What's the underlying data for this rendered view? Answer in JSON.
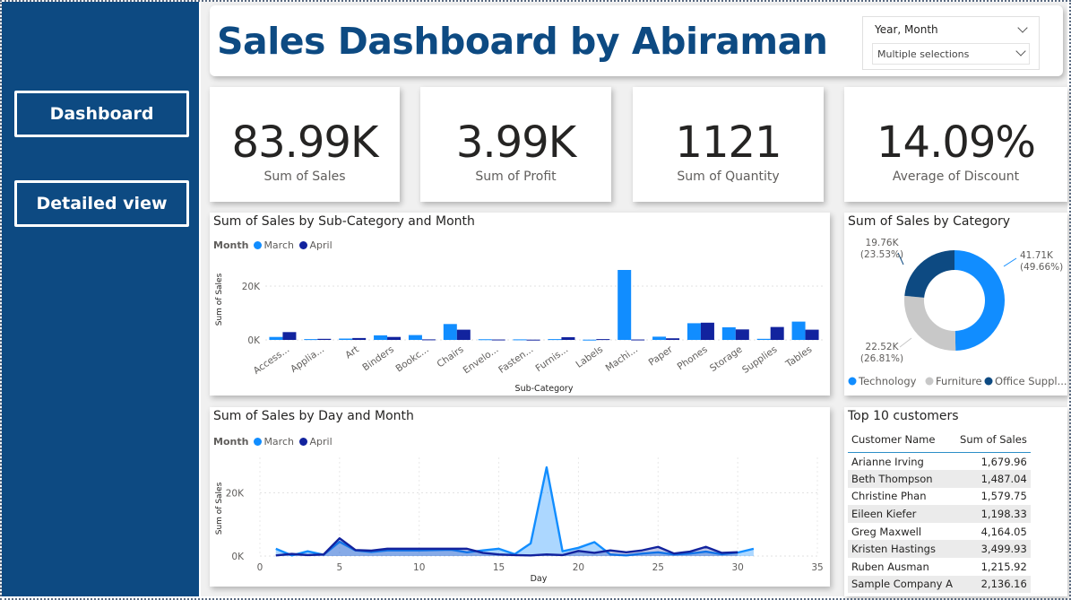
{
  "nav": {
    "dashboard": "Dashboard",
    "detailed": "Detailed view"
  },
  "header": {
    "title": "Sales Dashboard by Abiraman"
  },
  "slicer": {
    "label": "Year, Month",
    "value": "Multiple selections"
  },
  "kpis": [
    {
      "value": "83.99K",
      "label": "Sum of Sales"
    },
    {
      "value": "3.99K",
      "label": "Sum of Profit"
    },
    {
      "value": "1121",
      "label": "Sum of Quantity"
    },
    {
      "value": "14.09%",
      "label": "Average of Discount"
    }
  ],
  "colors": {
    "march": "#118dff",
    "april": "#12239e",
    "technology": "#118dff",
    "furniture": "#c8c8c8",
    "office": "#0d4a82",
    "nav_bg": "#0d4a82"
  },
  "charts": {
    "subcat": {
      "title": "Sum of Sales by Sub-Category and Month",
      "legend_title": "Month",
      "xlabel": "Sub-Category",
      "ylabel": "Sum of Sales",
      "yticks": [
        "20K",
        "0K"
      ]
    },
    "donut": {
      "title": "Sum of Sales by Category"
    },
    "daily": {
      "title": "Sum of Sales by Day and Month",
      "legend_title": "Month",
      "xlabel": "Day",
      "ylabel": "Sum of Sales",
      "yticks": [
        "20K",
        "0K"
      ]
    }
  },
  "chart_data": [
    {
      "type": "bar",
      "title": "Sum of Sales by Sub-Category and Month",
      "xlabel": "Sub-Category",
      "ylabel": "Sum of Sales",
      "ylim": [
        0,
        30000
      ],
      "legend_placement": "top-left",
      "categories": [
        "Access...",
        "Applia...",
        "Art",
        "Binders",
        "Bookc...",
        "Chairs",
        "Envelo...",
        "Fasten...",
        "Furnis...",
        "Labels",
        "Machi...",
        "Paper",
        "Phones",
        "Storage",
        "Supplies",
        "Tables"
      ],
      "series": [
        {
          "name": "March",
          "values": [
            1100,
            300,
            500,
            1700,
            1800,
            5900,
            250,
            200,
            300,
            100,
            26000,
            1200,
            6200,
            4700,
            400,
            6800
          ]
        },
        {
          "name": "April",
          "values": [
            2900,
            400,
            700,
            1100,
            200,
            3800,
            150,
            100,
            1000,
            300,
            150,
            600,
            6400,
            3900,
            4800,
            3800
          ]
        }
      ]
    },
    {
      "type": "pie",
      "title": "Sum of Sales by Category",
      "legend_placement": "bottom",
      "labels": [
        "Technology",
        "Furniture",
        "Office Suppl..."
      ],
      "values": [
        41710,
        22520,
        19760
      ],
      "value_labels": [
        "41.71K",
        "22.52K",
        "19.76K"
      ],
      "percent_labels": [
        "(49.66%)",
        "(26.81%)",
        "(23.53%)"
      ]
    },
    {
      "type": "area",
      "title": "Sum of Sales by Day and Month",
      "xlabel": "Day",
      "ylabel": "Sum of Sales",
      "xlim": [
        0,
        35
      ],
      "ylim": [
        0,
        30000
      ],
      "xticks": [
        0,
        5,
        10,
        15,
        20,
        25,
        30,
        35
      ],
      "legend_placement": "top-left",
      "series": [
        {
          "name": "March",
          "x": [
            1,
            2,
            3,
            4,
            5,
            6,
            7,
            8,
            9,
            10,
            11,
            12,
            13,
            14,
            15,
            16,
            17,
            18,
            19,
            20,
            21,
            22,
            23,
            24,
            25,
            26,
            27,
            28,
            29,
            30,
            31
          ],
          "values": [
            2300,
            200,
            1500,
            400,
            4500,
            1800,
            1300,
            1800,
            1800,
            1800,
            1900,
            2000,
            1200,
            1800,
            2300,
            600,
            4000,
            28000,
            1500,
            2600,
            4400,
            500,
            200,
            800,
            1200,
            500,
            800,
            1400,
            600,
            1100,
            2300
          ]
        },
        {
          "name": "April",
          "x": [
            1,
            2,
            3,
            4,
            5,
            6,
            7,
            8,
            9,
            10,
            11,
            12,
            13,
            14,
            15,
            16,
            17,
            18,
            19,
            20,
            21,
            22,
            23,
            24,
            25,
            26,
            27,
            28,
            29,
            30
          ],
          "values": [
            200,
            700,
            300,
            500,
            5600,
            1900,
            1700,
            2300,
            2300,
            2300,
            2300,
            2300,
            2300,
            1000,
            500,
            300,
            200,
            500,
            300,
            1600,
            1000,
            1800,
            1200,
            1800,
            2900,
            800,
            1400,
            2900,
            1000,
            1200
          ]
        }
      ]
    }
  ],
  "customers": {
    "title": "Top 10 customers",
    "columns": [
      "Customer Name",
      "Sum of Sales"
    ],
    "rows": [
      [
        "Arianne Irving",
        "1,679.96"
      ],
      [
        "Beth Thompson",
        "1,487.04"
      ],
      [
        "Christine Phan",
        "1,579.75"
      ],
      [
        "Eileen Kiefer",
        "1,198.33"
      ],
      [
        "Greg Maxwell",
        "4,164.05"
      ],
      [
        "Kristen Hastings",
        "3,499.93"
      ],
      [
        "Ruben Ausman",
        "1,215.92"
      ],
      [
        "Sample Company A",
        "2,136.16"
      ]
    ]
  }
}
